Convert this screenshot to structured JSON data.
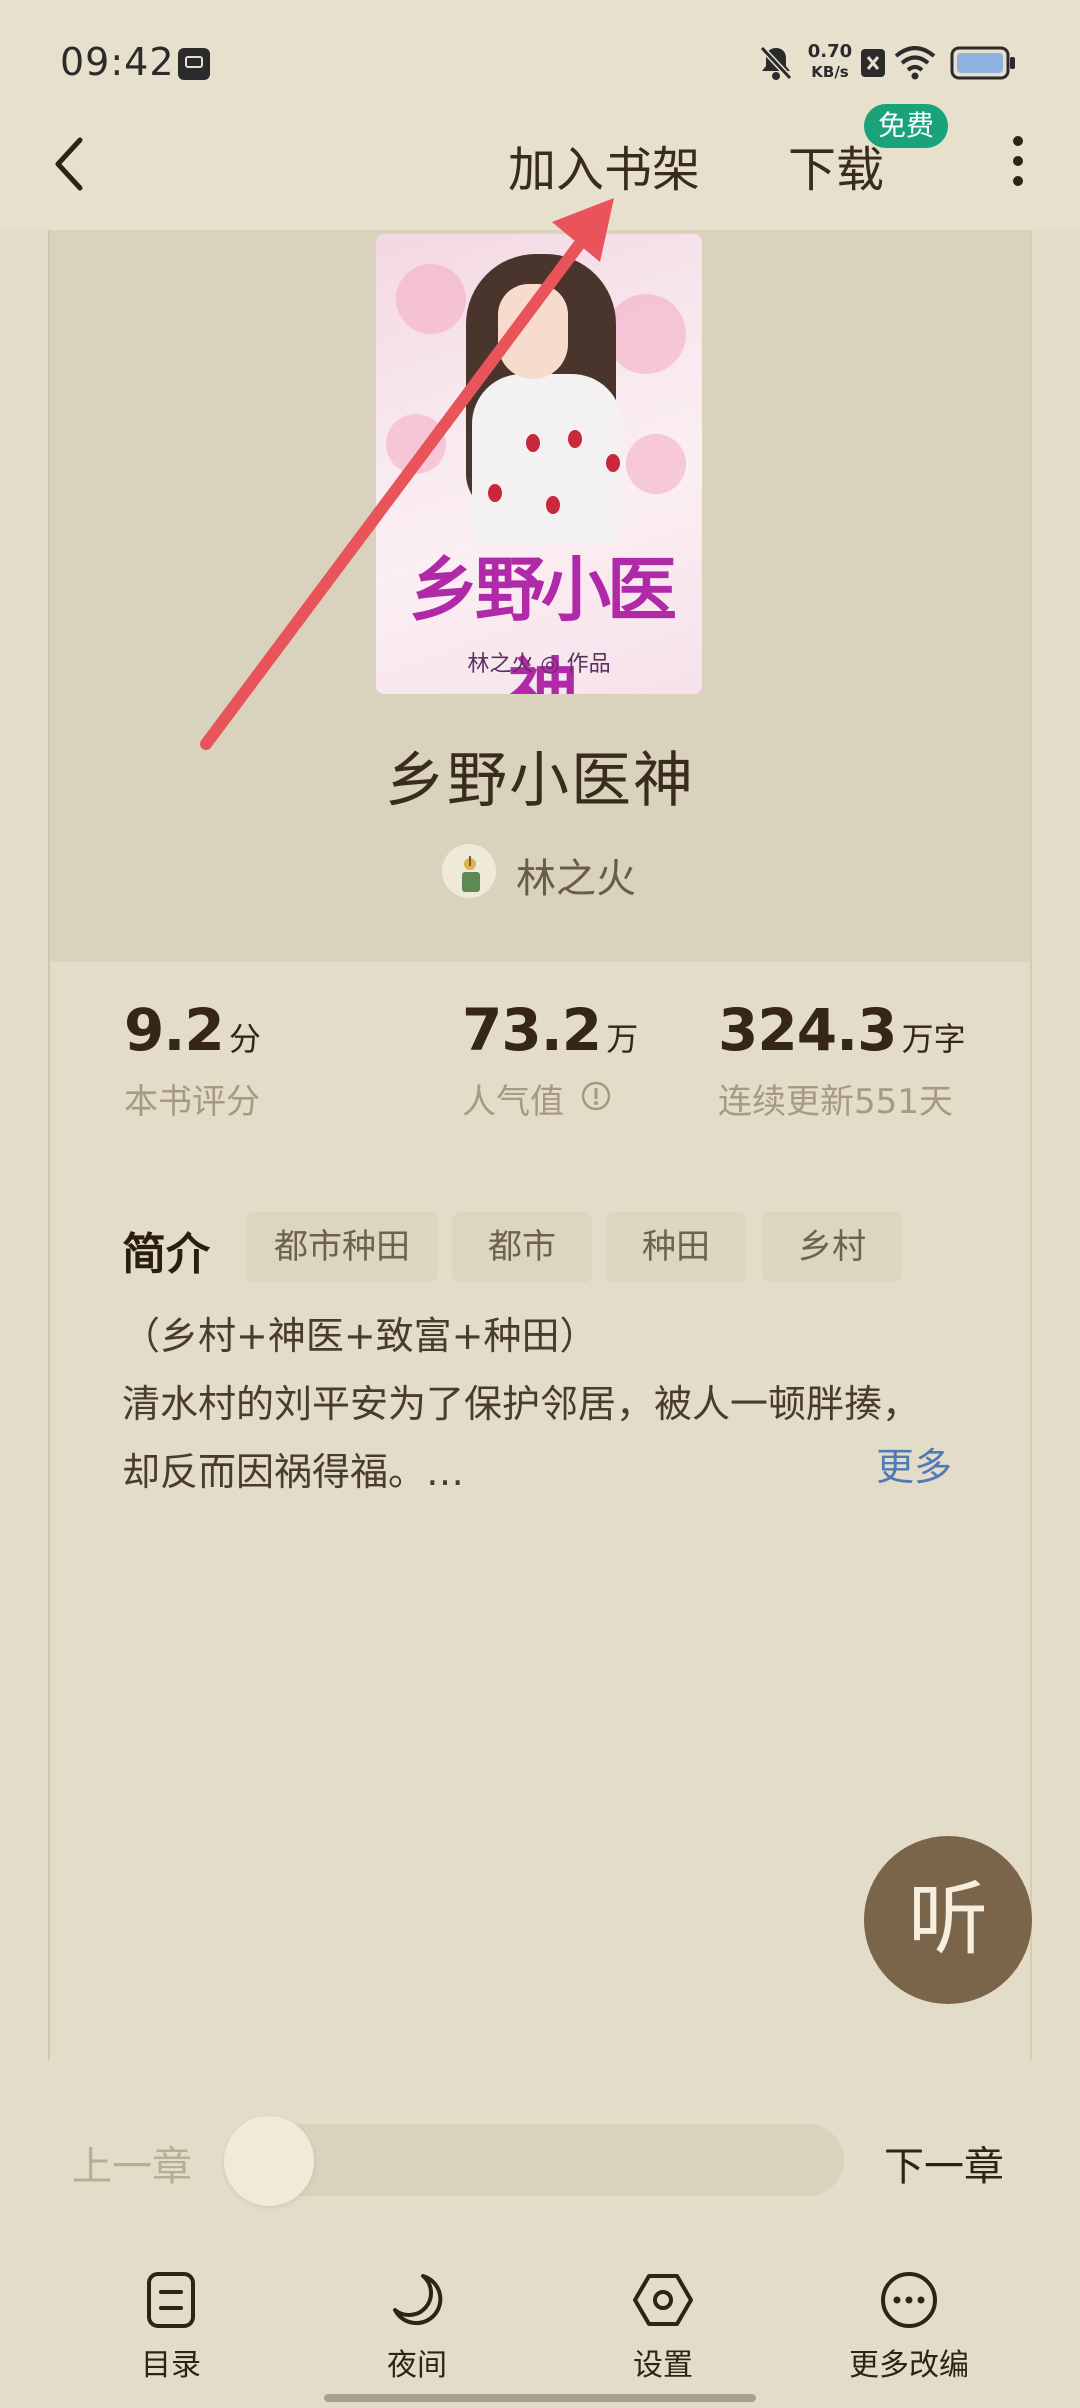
{
  "status_bar": {
    "time": "09:42",
    "net_speed_value": "0.70",
    "net_speed_unit": "KB/s"
  },
  "header": {
    "add_to_shelf": "加入书架",
    "download": "下载",
    "free_badge": "免费"
  },
  "book": {
    "cover_title": "乡野小医神",
    "cover_author": "林之火 ◎ 作品",
    "title": "乡野小医神",
    "author": "林之火"
  },
  "stats": [
    {
      "value": "9.2",
      "unit": "分",
      "label": "本书评分"
    },
    {
      "value": "73.2",
      "unit": "万",
      "label": "人气值"
    },
    {
      "value": "324.3",
      "unit": "万字",
      "label": "连续更新551天"
    }
  ],
  "intro": {
    "label": "简介",
    "tags": [
      "都市种田",
      "都市",
      "种田",
      "乡村"
    ],
    "lines": [
      "（乡村+神医+致富+种田）",
      "清水村的刘平安为了保护邻居，被人一顿胖揍，",
      "却反而因祸得福。…"
    ],
    "more": "更多"
  },
  "listen_button": "听",
  "reader": {
    "prev_chapter": "上一章",
    "next_chapter": "下一章",
    "progress": 0
  },
  "bottom_nav": [
    {
      "label": "目录",
      "icon": "list-icon"
    },
    {
      "label": "夜间",
      "icon": "moon-icon"
    },
    {
      "label": "设置",
      "icon": "settings-hexagon-icon"
    },
    {
      "label": "更多改编",
      "icon": "more-circle-icon"
    }
  ],
  "colors": {
    "background": "#e3dcc8",
    "panel": "#d9d2bd",
    "accent_link": "#4e7bb5",
    "free_badge": "#1aa37a",
    "listen": "#7a654a",
    "arrow": "#e8545a"
  }
}
